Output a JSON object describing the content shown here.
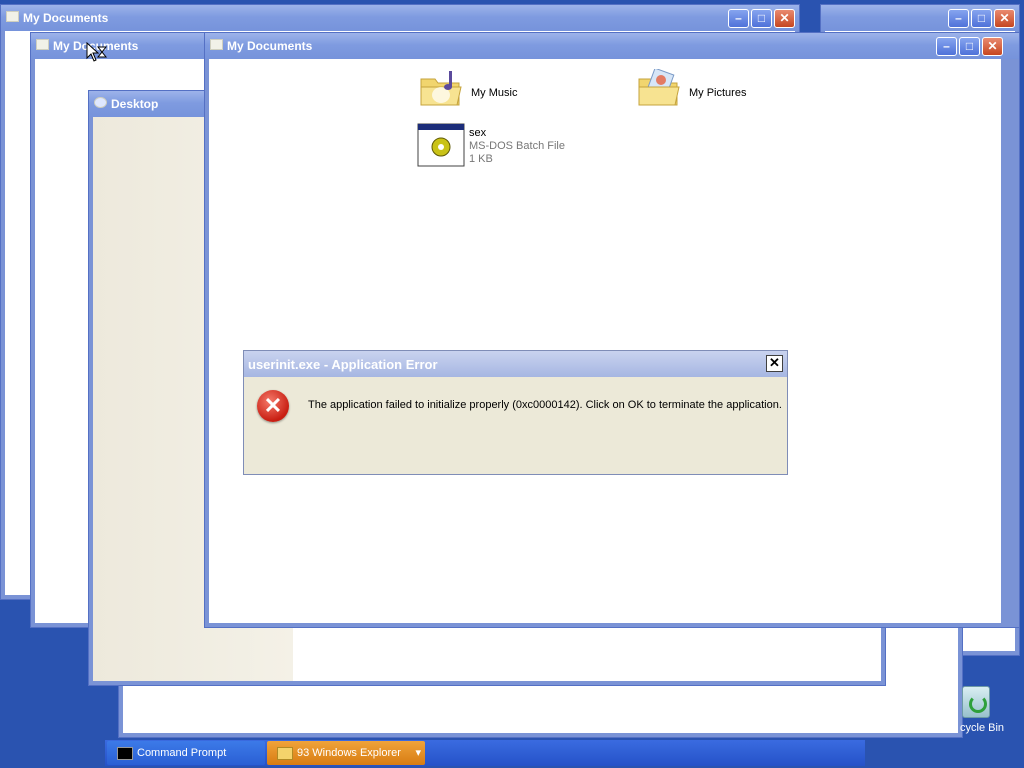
{
  "windows": {
    "back1": {
      "title": "My Documents"
    },
    "back2": {
      "title": "My Documents"
    },
    "desktop": {
      "title": "Desktop"
    },
    "front": {
      "title": "My Documents"
    }
  },
  "folder_items": [
    {
      "name": "My Music",
      "icon": "music-folder-icon"
    },
    {
      "name": "My Pictures",
      "icon": "pictures-folder-icon"
    }
  ],
  "file_item": {
    "name": "sex",
    "type": "MS-DOS Batch File",
    "size": "1 KB",
    "icon": "batch-file-icon"
  },
  "dialog": {
    "title": "userinit.exe - Application Error",
    "message": "The application failed to initialize properly (0xc0000142). Click on OK to terminate the application.",
    "close_glyph": "✕",
    "error_glyph": "✕"
  },
  "window_buttons": {
    "minimize": "–",
    "maximize": "□",
    "close": "✕"
  },
  "taskbar": {
    "items": [
      {
        "label": "Command Prompt",
        "icon": "command-prompt-icon"
      },
      {
        "label": "93 Windows Explorer",
        "icon": "folder-icon"
      }
    ],
    "group_arrow": "▾"
  },
  "desktop_icons": {
    "recycle_bin_label": "cycle Bin"
  },
  "colors": {
    "desktop_bg": "#2a53b0",
    "dialog_bg": "#ece9d8",
    "taskbar_group": "#e8891c"
  }
}
